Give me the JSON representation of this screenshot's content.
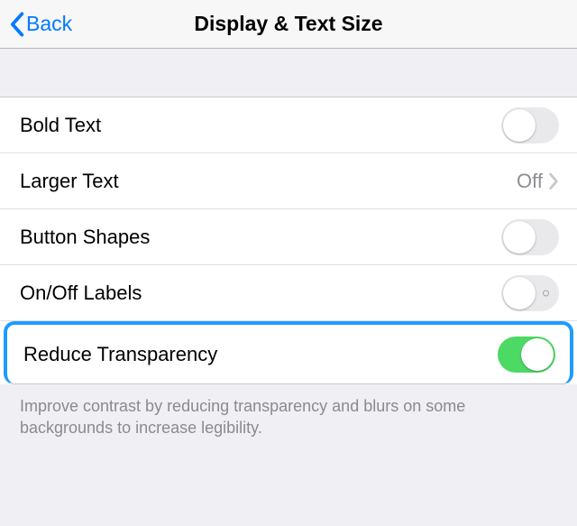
{
  "nav": {
    "back_label": "Back",
    "title": "Display & Text Size"
  },
  "rows": {
    "bold_text": {
      "label": "Bold Text"
    },
    "larger_text": {
      "label": "Larger Text",
      "value": "Off"
    },
    "button_shapes": {
      "label": "Button Shapes"
    },
    "onoff_labels": {
      "label": "On/Off Labels"
    },
    "reduce_transparency": {
      "label": "Reduce Transparency"
    }
  },
  "footer": "Improve contrast by reducing transparency and blurs on some backgrounds to increase legibility."
}
